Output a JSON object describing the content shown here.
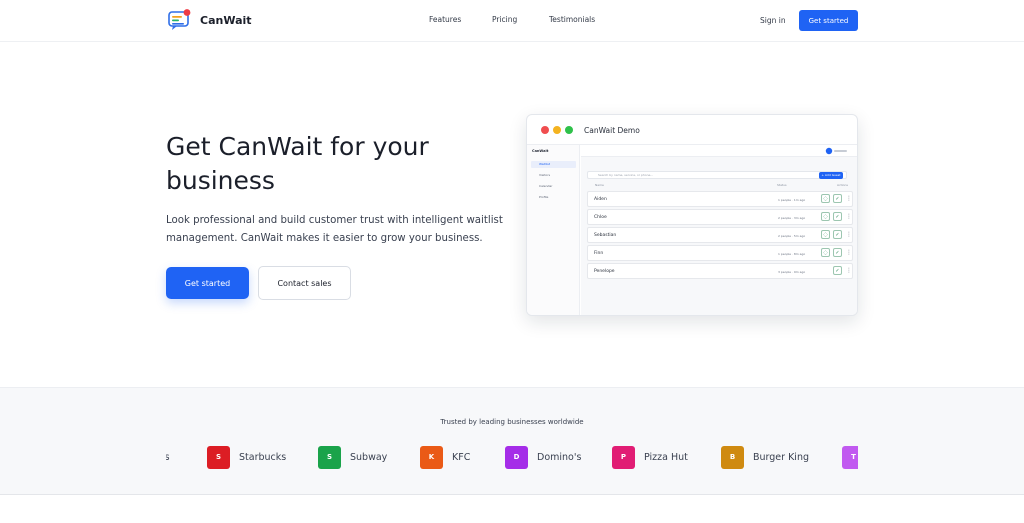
{
  "header": {
    "brand": "CanWait",
    "nav": [
      "Features",
      "Pricing",
      "Testimonials"
    ],
    "signin": "Sign in",
    "cta": "Get started"
  },
  "hero": {
    "title_line1": "Get CanWait for your",
    "title_line2": "business",
    "subtitle_line1": "Look professional and build customer trust with intelligent waitlist",
    "subtitle_line2": "management. CanWait makes it easier to grow your business.",
    "primary_cta": "Get started",
    "secondary_cta": "Contact sales"
  },
  "demo": {
    "window_title": "CanWait Demo",
    "app_name": "CanWait",
    "sidebar": [
      "Waitlist",
      "Visitors",
      "Calendar",
      "Profile"
    ],
    "search_placeholder": "Search by name, service, or phone...",
    "add_button": "+ Add Guest",
    "columns": [
      "Name",
      "Status",
      "Actions"
    ],
    "rows": [
      {
        "name": "Aiden",
        "meta": "1 people · 1m ago"
      },
      {
        "name": "Chloe",
        "meta": "2 people · 3m ago"
      },
      {
        "name": "Sebastian",
        "meta": "2 people · 5m ago"
      },
      {
        "name": "Finn",
        "meta": "1 people · 8m ago"
      },
      {
        "name": "Penelope",
        "meta": "3 people · 9m ago"
      }
    ]
  },
  "trusted": {
    "heading": "Trusted by leading businesses worldwide",
    "logos": [
      {
        "letter": "",
        "name": "'s",
        "color": "#ffffff"
      },
      {
        "letter": "S",
        "name": "Starbucks",
        "color": "#dc1d24"
      },
      {
        "letter": "S",
        "name": "Subway",
        "color": "#1aa34a"
      },
      {
        "letter": "K",
        "name": "KFC",
        "color": "#ea5a16"
      },
      {
        "letter": "D",
        "name": "Domino's",
        "color": "#a52de8"
      },
      {
        "letter": "P",
        "name": "Pizza Hut",
        "color": "#e11d74"
      },
      {
        "letter": "B",
        "name": "Burger King",
        "color": "#cf8a10"
      },
      {
        "letter": "T",
        "name": "",
        "color": "#c15af0"
      }
    ]
  },
  "colors": {
    "accent": "#1f63f4"
  }
}
